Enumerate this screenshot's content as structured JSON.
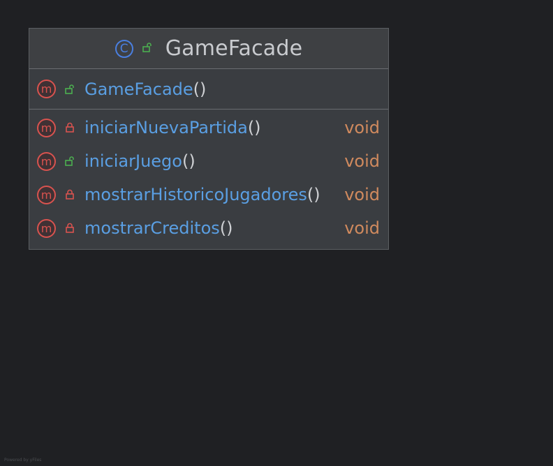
{
  "class": {
    "name": "GameFacade",
    "icon": "class-icon",
    "visibility": "public"
  },
  "constructor": {
    "name": "GameFacade",
    "parens": "()",
    "visibility": "public"
  },
  "methods": [
    {
      "name": "iniciarNuevaPartida",
      "parens": "()",
      "return_type": "void",
      "visibility": "private"
    },
    {
      "name": "iniciarJuego",
      "parens": "()",
      "return_type": "void",
      "visibility": "public"
    },
    {
      "name": "mostrarHistoricoJugadores",
      "parens": "()",
      "return_type": "void",
      "visibility": "private"
    },
    {
      "name": "mostrarCreditos",
      "parens": "()",
      "return_type": "void",
      "visibility": "private"
    }
  ],
  "icons": {
    "class_glyph": "C",
    "method_glyph": "m"
  },
  "footer": "Powered by yFiles",
  "colors": {
    "background": "#1f2023",
    "method_name": "#5a9fe3",
    "return_type": "#d08a5e",
    "method_icon": "#d9534f",
    "class_icon": "#4a7fe0",
    "public_lock": "#4caf50",
    "private_lock": "#d9534f"
  }
}
